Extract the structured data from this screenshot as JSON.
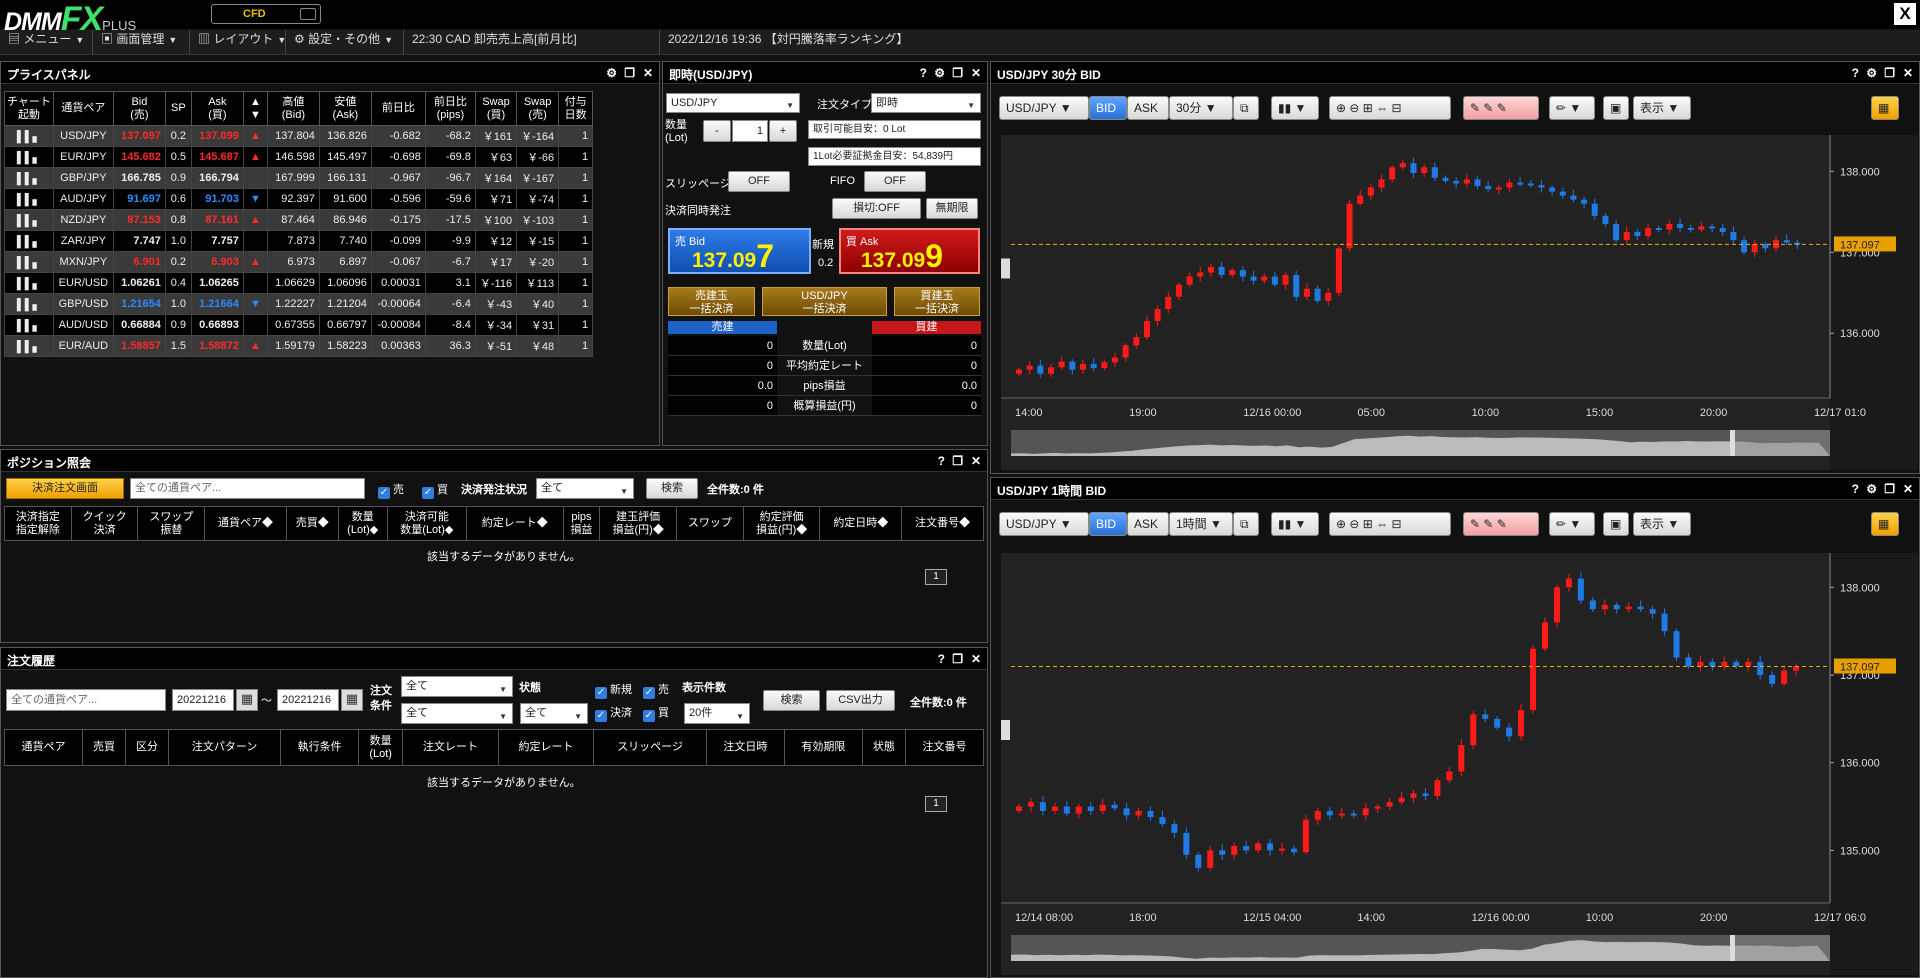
{
  "app": {
    "logo_dmm": "DMM",
    "logo_fx": "FX",
    "logo_plus": "PLUS",
    "cfd": "CFD",
    "close": "X"
  },
  "menubar": {
    "menu": "メニュー",
    "screen": "画面管理",
    "layout": "レイアウト",
    "settings": "設定・その他",
    "ticker1": "22:30  CAD  卸売売上高[前月比]",
    "ticker2": "2022/12/16 19:36 【対円騰落率ランキング】"
  },
  "price_panel": {
    "title": "プライスパネル",
    "headers": [
      "チャート\n起動",
      "通貨ペア",
      "Bid\n(売)",
      "SP",
      "Ask\n(買)",
      "▲\n▼",
      "高値\n(Bid)",
      "安値\n(Ask)",
      "前日比",
      "前日比\n(pips)",
      "Swap\n(買)",
      "Swap\n(売)",
      "付与\n日数"
    ],
    "rows": [
      {
        "pair": "USD/JPY",
        "bid": "137.097",
        "sp": "0.2",
        "ask": "137.099",
        "dir": "▲",
        "high": "137.804",
        "low": "136.826",
        "chg": "-0.682",
        "pips": "-68.2",
        "swb": "￥161",
        "sws": "￥-164",
        "days": "1",
        "color": "red"
      },
      {
        "pair": "EUR/JPY",
        "bid": "145.682",
        "sp": "0.5",
        "ask": "145.687",
        "dir": "▲",
        "high": "146.598",
        "low": "145.497",
        "chg": "-0.698",
        "pips": "-69.8",
        "swb": "￥63",
        "sws": "￥-66",
        "days": "1",
        "color": "red"
      },
      {
        "pair": "GBP/JPY",
        "bid": "166.785",
        "sp": "0.9",
        "ask": "166.794",
        "dir": "",
        "high": "167.999",
        "low": "166.131",
        "chg": "-0.967",
        "pips": "-96.7",
        "swb": "￥164",
        "sws": "￥-167",
        "days": "1",
        "color": "white"
      },
      {
        "pair": "AUD/JPY",
        "bid": "91.697",
        "sp": "0.6",
        "ask": "91.703",
        "dir": "▼",
        "high": "92.397",
        "low": "91.600",
        "chg": "-0.596",
        "pips": "-59.6",
        "swb": "￥71",
        "sws": "￥-74",
        "days": "1",
        "color": "blue"
      },
      {
        "pair": "NZD/JPY",
        "bid": "87.153",
        "sp": "0.8",
        "ask": "87.161",
        "dir": "▲",
        "high": "87.464",
        "low": "86.946",
        "chg": "-0.175",
        "pips": "-17.5",
        "swb": "￥100",
        "sws": "￥-103",
        "days": "1",
        "color": "red"
      },
      {
        "pair": "ZAR/JPY",
        "bid": "7.747",
        "sp": "1.0",
        "ask": "7.757",
        "dir": "",
        "high": "7.873",
        "low": "7.740",
        "chg": "-0.099",
        "pips": "-9.9",
        "swb": "￥12",
        "sws": "￥-15",
        "days": "1",
        "color": "white"
      },
      {
        "pair": "MXN/JPY",
        "bid": "6.901",
        "sp": "0.2",
        "ask": "6.903",
        "dir": "▲",
        "high": "6.973",
        "low": "6.897",
        "chg": "-0.067",
        "pips": "-6.7",
        "swb": "￥17",
        "sws": "￥-20",
        "days": "1",
        "color": "red"
      },
      {
        "pair": "EUR/USD",
        "bid": "1.06261",
        "sp": "0.4",
        "ask": "1.06265",
        "dir": "",
        "high": "1.06629",
        "low": "1.06096",
        "chg": "0.00031",
        "pips": "3.1",
        "swb": "￥-116",
        "sws": "￥113",
        "days": "1",
        "color": "white"
      },
      {
        "pair": "GBP/USD",
        "bid": "1.21654",
        "sp": "1.0",
        "ask": "1.21664",
        "dir": "▼",
        "high": "1.22227",
        "low": "1.21204",
        "chg": "-0.00064",
        "pips": "-6.4",
        "swb": "￥-43",
        "sws": "￥40",
        "days": "1",
        "color": "blue"
      },
      {
        "pair": "AUD/USD",
        "bid": "0.66884",
        "sp": "0.9",
        "ask": "0.66893",
        "dir": "",
        "high": "0.67355",
        "low": "0.66797",
        "chg": "-0.00084",
        "pips": "-8.4",
        "swb": "￥-34",
        "sws": "￥31",
        "days": "1",
        "color": "white"
      },
      {
        "pair": "EUR/AUD",
        "bid": "1.58857",
        "sp": "1.5",
        "ask": "1.58872",
        "dir": "▲",
        "high": "1.59179",
        "low": "1.58223",
        "chg": "0.00363",
        "pips": "36.3",
        "swb": "￥-51",
        "sws": "￥48",
        "days": "1",
        "color": "red"
      }
    ]
  },
  "order_panel": {
    "title": "即時(USD/JPY)",
    "pair": "USD/JPY",
    "order_type_label": "注文タイプ",
    "order_type": "即時",
    "qty_label": "数量\n(Lot)",
    "qty": "1",
    "minus": "-",
    "plus": "+",
    "avail": "取引可能目安：0 Lot",
    "margin": "1Lot必要証拠金目安：54,839円",
    "slip_label": "スリッページ",
    "slip": "OFF",
    "fifo_label": "FIFO",
    "fifo": "OFF",
    "settle_label": "決済同時発注",
    "loss_cut": "損切:OFF",
    "limit": "無期限",
    "bid_label": "売 Bid",
    "bid_big": "137.09",
    "bid_small": "7",
    "ask_label": "買 Ask",
    "ask_big": "137.09",
    "ask_small": "9",
    "new_label": "新規",
    "spread": "0.2",
    "sell_all": "売建玉\n一括決済",
    "pair_all": "USD/JPY\n一括決済",
    "buy_all": "買建玉\n一括決済",
    "sell_head": "売建",
    "buy_head": "買建",
    "stats": [
      {
        "s": "0",
        "l": "数量(Lot)",
        "b": "0"
      },
      {
        "s": "0",
        "l": "平均約定レート",
        "b": "0"
      },
      {
        "s": "0.0",
        "l": "pips損益",
        "b": "0.0"
      },
      {
        "s": "0",
        "l": "概算損益(円)",
        "b": "0"
      }
    ]
  },
  "position_panel": {
    "title": "ポジション照会",
    "settle_btn": "決済注文画面",
    "pair_ph": "全ての通貨ペア...",
    "sell": "売",
    "buy": "買",
    "status_label": "決済発注状況",
    "status": "全て",
    "search": "検索",
    "count": "全件数:0 件",
    "headers": [
      "決済指定\n指定解除",
      "クイック\n決済",
      "スワップ\n振替",
      "通貨ペア◆",
      "売買◆",
      "数量\n(Lot)◆",
      "決済可能\n数量(Lot)◆",
      "約定レート◆",
      "pips\n損益",
      "建玉評価\n損益(円)◆",
      "スワップ",
      "約定評価\n損益(円)◆",
      "約定日時◆",
      "注文番号◆"
    ],
    "empty": "該当するデータがありません。",
    "page": "1"
  },
  "history_panel": {
    "title": "注文履歴",
    "pair_ph": "全ての通貨ペア...",
    "from": "20221216",
    "tilde": "〜",
    "to": "20221216",
    "cond_label": "注文\n条件",
    "cond1": "全て",
    "cond2": "全て",
    "state_label": "状態",
    "state": "全て",
    "new": "新規",
    "sell": "売",
    "settle": "決済",
    "buy": "買",
    "disp_label": "表示件数",
    "disp": "20件",
    "search": "検索",
    "csv": "CSV出力",
    "count": "全件数:0 件",
    "headers": [
      "通貨ペア",
      "売買",
      "区分",
      "注文パターン",
      "執行条件",
      "数量\n(Lot)",
      "注文レート",
      "約定レート",
      "スリッページ",
      "注文日時",
      "有効期限",
      "状態",
      "注文番号"
    ],
    "empty": "該当するデータがありません。",
    "page": "1"
  },
  "chart_data": [
    {
      "type": "candlestick",
      "title": "USD/JPY 30分 BID",
      "pair": "USD/JPY",
      "bid": "BID",
      "ask": "ASK",
      "interval": "30分",
      "display": "表示",
      "current": "137.097",
      "ylim": [
        135.2,
        138.35
      ],
      "yticks": [
        "138.000",
        "137.000",
        "136.000"
      ],
      "xticks": [
        "14:00",
        "19:00",
        "12/16 00:00",
        "05:00",
        "10:00",
        "15:00",
        "20:00",
        "12/17 01:0"
      ],
      "closes": [
        135.55,
        135.6,
        135.5,
        135.58,
        135.65,
        135.55,
        135.62,
        135.57,
        135.64,
        135.7,
        135.85,
        135.95,
        136.15,
        136.3,
        136.45,
        136.6,
        136.7,
        136.75,
        136.82,
        136.72,
        136.78,
        136.7,
        136.65,
        136.7,
        136.6,
        136.72,
        136.45,
        136.55,
        136.4,
        136.5,
        137.05,
        137.6,
        137.7,
        137.8,
        137.9,
        138.05,
        138.1,
        137.98,
        138.05,
        137.92,
        137.88,
        137.85,
        137.9,
        137.82,
        137.78,
        137.8,
        137.86,
        137.85,
        137.83,
        137.8,
        137.75,
        137.7,
        137.65,
        137.6,
        137.45,
        137.35,
        137.15,
        137.25,
        137.2,
        137.3,
        137.28,
        137.35,
        137.3,
        137.28,
        137.32,
        137.3,
        137.25,
        137.15,
        137.0,
        137.1,
        137.05,
        137.15,
        137.12,
        137.1
      ]
    },
    {
      "type": "candlestick",
      "title": "USD/JPY 1時間 BID",
      "pair": "USD/JPY",
      "bid": "BID",
      "ask": "ASK",
      "interval": "1時間",
      "display": "表示",
      "current": "137.097",
      "ylim": [
        134.4,
        138.3
      ],
      "yticks": [
        "138.000",
        "137.000",
        "136.000",
        "135.000"
      ],
      "xticks": [
        "12/14 08:00",
        "18:00",
        "12/15 04:00",
        "14:00",
        "12/16 00:00",
        "10:00",
        "20:00",
        "12/17 06:0"
      ],
      "closes": [
        135.5,
        135.55,
        135.45,
        135.5,
        135.42,
        135.5,
        135.45,
        135.52,
        135.48,
        135.4,
        135.45,
        135.38,
        135.3,
        135.2,
        134.95,
        134.8,
        135.0,
        134.95,
        135.05,
        135.0,
        135.08,
        135.0,
        135.02,
        134.98,
        135.35,
        135.45,
        135.4,
        135.42,
        135.4,
        135.48,
        135.5,
        135.55,
        135.6,
        135.65,
        135.62,
        135.8,
        135.9,
        136.2,
        136.55,
        136.5,
        136.4,
        136.3,
        136.6,
        137.3,
        137.6,
        138.0,
        138.1,
        137.85,
        137.75,
        137.8,
        137.75,
        137.78,
        137.75,
        137.7,
        137.5,
        137.2,
        137.1,
        137.15,
        137.1,
        137.15,
        137.1,
        137.15,
        137.0,
        136.9,
        137.05,
        137.1
      ]
    }
  ]
}
